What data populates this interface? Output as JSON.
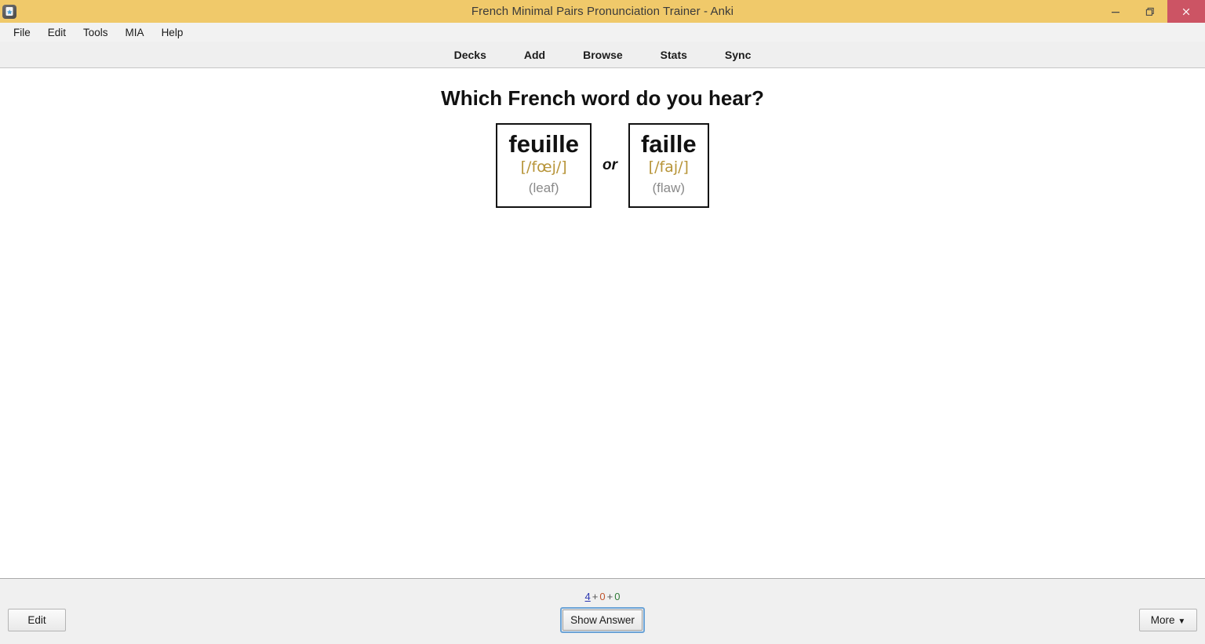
{
  "window": {
    "title": "French Minimal Pairs Pronunciation Trainer - Anki",
    "app_icon": "anki-app-icon",
    "controls": {
      "minimize": "minimize-icon",
      "restore": "restore-icon",
      "close": "close-icon"
    },
    "accent_title_bar": "#f0c96a",
    "close_button_color": "#cc5464"
  },
  "menu": {
    "items": [
      {
        "label": "File"
      },
      {
        "label": "Edit"
      },
      {
        "label": "Tools"
      },
      {
        "label": "MIA"
      },
      {
        "label": "Help"
      }
    ]
  },
  "nav": {
    "items": [
      {
        "label": "Decks"
      },
      {
        "label": "Add"
      },
      {
        "label": "Browse"
      },
      {
        "label": "Stats"
      },
      {
        "label": "Sync"
      }
    ]
  },
  "card": {
    "question": "Which French word do you hear?",
    "separator": "or",
    "ipa_color": "#b79438",
    "gloss_color": "#8a8a8a",
    "options": [
      {
        "word": "feuille",
        "ipa": "[/fœj/]",
        "gloss": "(leaf)"
      },
      {
        "word": "faille",
        "ipa": "[/faj/]",
        "gloss": "(flaw)"
      }
    ]
  },
  "bottom": {
    "edit_label": "Edit",
    "more_label": "More",
    "more_caret": "▼",
    "show_answer_label": "Show Answer",
    "counts": {
      "new": "4",
      "plus1": "+",
      "learning": "0",
      "plus2": "+",
      "review": "0",
      "new_color": "#2b36b0",
      "learning_color": "#c0542c",
      "review_color": "#2f7a37"
    }
  }
}
